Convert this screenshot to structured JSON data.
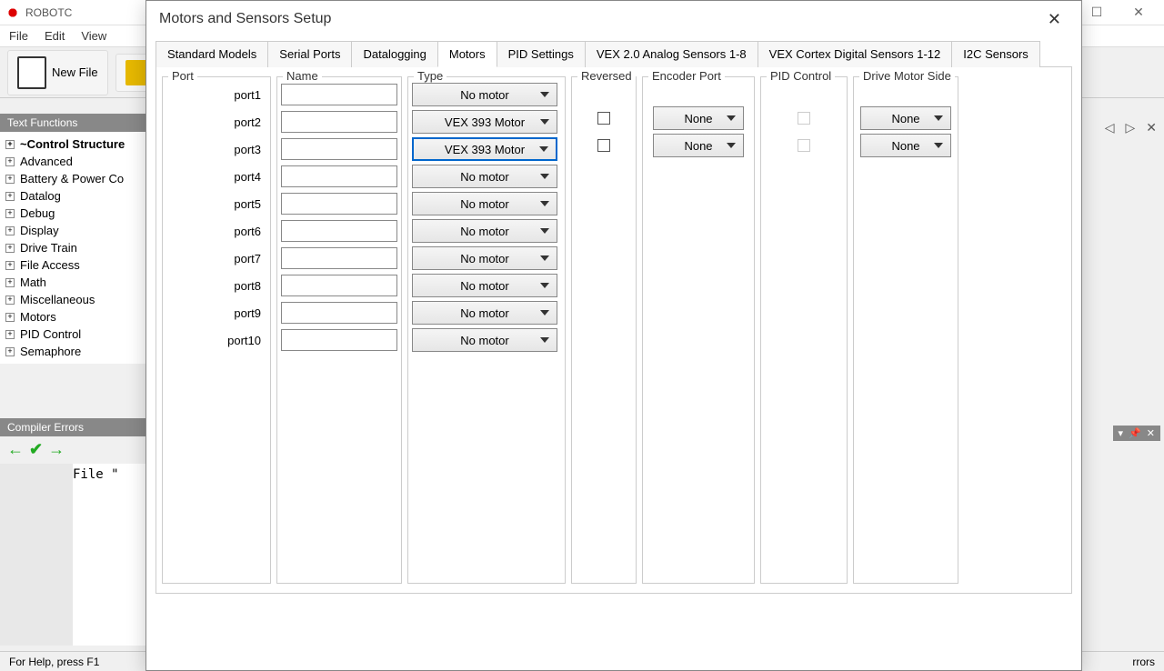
{
  "main": {
    "title": "ROBOTC",
    "menus": [
      "File",
      "Edit",
      "View"
    ],
    "toolbar": {
      "newfile": "New File"
    },
    "textFunctionsHeader": "Text Functions",
    "tree": [
      {
        "label": "~Control Structure",
        "bold": true
      },
      {
        "label": "Advanced"
      },
      {
        "label": "Battery & Power Co"
      },
      {
        "label": "Datalog"
      },
      {
        "label": "Debug"
      },
      {
        "label": "Display"
      },
      {
        "label": "Drive Train"
      },
      {
        "label": "File Access"
      },
      {
        "label": "Math"
      },
      {
        "label": "Miscellaneous"
      },
      {
        "label": "Motors"
      },
      {
        "label": "PID Control"
      },
      {
        "label": "Semaphore"
      }
    ],
    "compilerErrorsHeader": "Compiler Errors",
    "codeText": "File \"",
    "statusLeft": "For Help, press F1",
    "statusRight": "rrors"
  },
  "dialog": {
    "title": "Motors and Sensors Setup",
    "tabs": [
      "Standard Models",
      "Serial Ports",
      "Datalogging",
      "Motors",
      "PID Settings",
      "VEX 2.0 Analog Sensors 1-8",
      "VEX Cortex Digital Sensors 1-12",
      "I2C Sensors"
    ],
    "activeTab": "Motors",
    "columns": {
      "port": "Port",
      "name": "Name",
      "type": "Type",
      "reversed": "Reversed",
      "encoder": "Encoder Port",
      "pid": "PID Control",
      "drive": "Drive Motor Side"
    },
    "ports": [
      "port1",
      "port2",
      "port3",
      "port4",
      "port5",
      "port6",
      "port7",
      "port8",
      "port9",
      "port10"
    ],
    "types": [
      "No motor",
      "VEX 393 Motor",
      "VEX 393 Motor",
      "No motor",
      "No motor",
      "No motor",
      "No motor",
      "No motor",
      "No motor",
      "No motor"
    ],
    "encoderOptions": [
      "None",
      "None"
    ],
    "driveOptions": [
      "None",
      "None"
    ]
  }
}
